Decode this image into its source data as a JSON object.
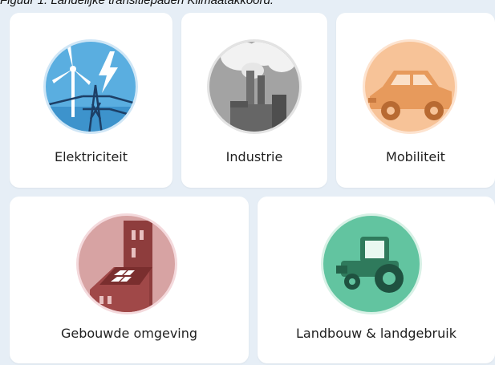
{
  "caption": "Figuur 1. Landelijke transitiepaden Klimaatakkoord.",
  "tiles": [
    {
      "label": "Elektriciteit",
      "icon": "wind-turbine-lightning-icon",
      "color": "#5aaee0"
    },
    {
      "label": "Industrie",
      "icon": "factory-icon",
      "color": "#9a9a9a"
    },
    {
      "label": "Mobiliteit",
      "icon": "car-icon",
      "color": "#f4b37b"
    },
    {
      "label": "Gebouwde omgeving",
      "icon": "building-solar-icon",
      "color": "#b76868"
    },
    {
      "label": "Landbouw & landgebruik",
      "icon": "tractor-icon",
      "color": "#5cbf99"
    }
  ]
}
